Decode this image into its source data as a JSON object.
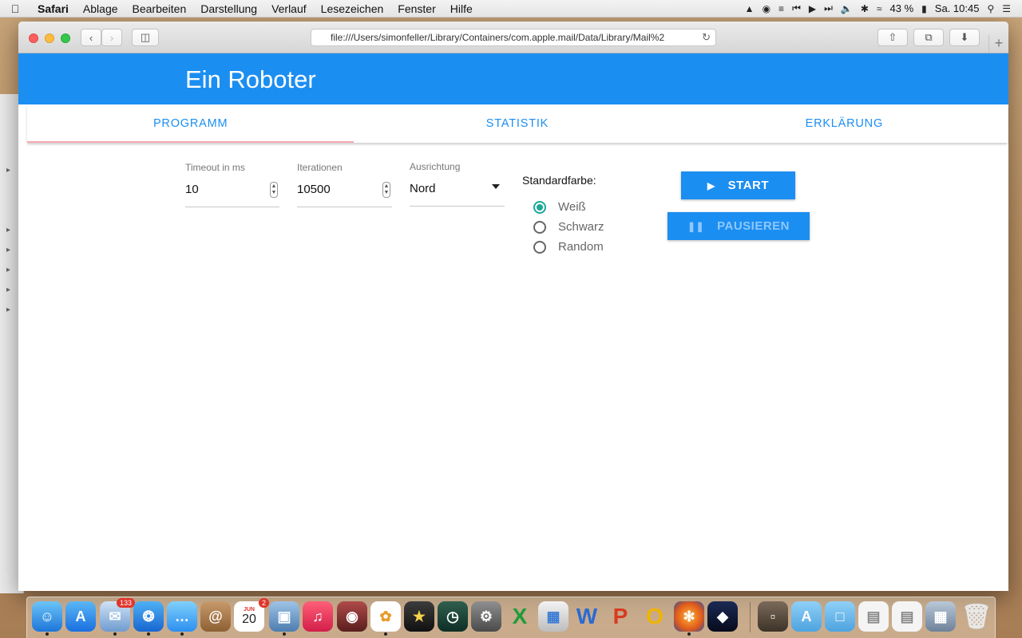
{
  "menubar": {
    "items": [
      "Safari",
      "Ablage",
      "Bearbeiten",
      "Darstellung",
      "Verlauf",
      "Lesezeichen",
      "Fenster",
      "Hilfe"
    ],
    "battery": "43 %",
    "clock": "Sa. 10:45"
  },
  "browser": {
    "url": "file:///Users/simonfeller/Library/Containers/com.apple.mail/Data/Library/Mail%2"
  },
  "app": {
    "title": "Ein Roboter",
    "tabs": [
      "PROGRAMM",
      "STATISTIK",
      "ERKLÄRUNG"
    ],
    "active_tab": "PROGRAMM",
    "timeout": {
      "label": "Timeout in ms",
      "value": "10"
    },
    "iterations": {
      "label": "Iterationen",
      "value": "10500"
    },
    "orientation": {
      "label": "Ausrichtung",
      "value": "Nord"
    },
    "color": {
      "label": "Standardfarbe:",
      "options": [
        "Weiß",
        "Schwarz",
        "Random"
      ],
      "selected": "Weiß"
    },
    "start_label": "START",
    "pause_label": "PAUSIEREN"
  },
  "dock": {
    "mail_badge": "133",
    "calendar_badge": "2",
    "calendar_month": "JUN",
    "calendar_day": "20"
  },
  "colors": {
    "app_bar": "#1b8ef2",
    "radio_selected": "#1aa898",
    "tab_indicator": "#f7a9b3"
  }
}
